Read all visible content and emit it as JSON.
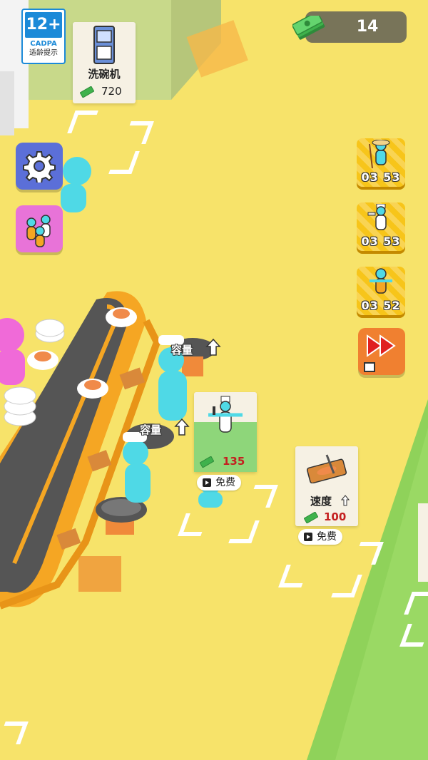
{
  "rating": {
    "age": "12+",
    "org": "CADPA",
    "tip": "适龄提示"
  },
  "currency": {
    "amount": "14",
    "icon": "cash-stack-icon"
  },
  "machines": [
    {
      "name": "洗碗机",
      "price": "720",
      "icon": "dishwasher-icon"
    }
  ],
  "side_menu": {
    "settings_icon": "gear-icon",
    "staff_icon": "staff-group-icon"
  },
  "boosters": [
    {
      "icon": "fisher-worker-icon",
      "timer": "03 53"
    },
    {
      "icon": "chef-worker-icon",
      "timer": "03 53"
    },
    {
      "icon": "waiter-worker-icon",
      "timer": "03 52"
    }
  ],
  "fast_forward": {
    "icon": "fast-forward-icon",
    "badge_icon": "video-icon"
  },
  "capacity_label": "容量",
  "hire_panel": {
    "price": "135",
    "free_label": "免费",
    "icon": "chef-hire-icon"
  },
  "speed_panel": {
    "label": "速度",
    "price": "100",
    "free_label": "免费",
    "icon": "knife-board-icon"
  },
  "colors": {
    "floor": "#f7e36a",
    "accent_yellow": "#f7c51a",
    "booster_red": "#f08030",
    "settings_blue": "#5b6fd8",
    "staff_pink": "#e873d8",
    "price_red": "#c42020"
  }
}
